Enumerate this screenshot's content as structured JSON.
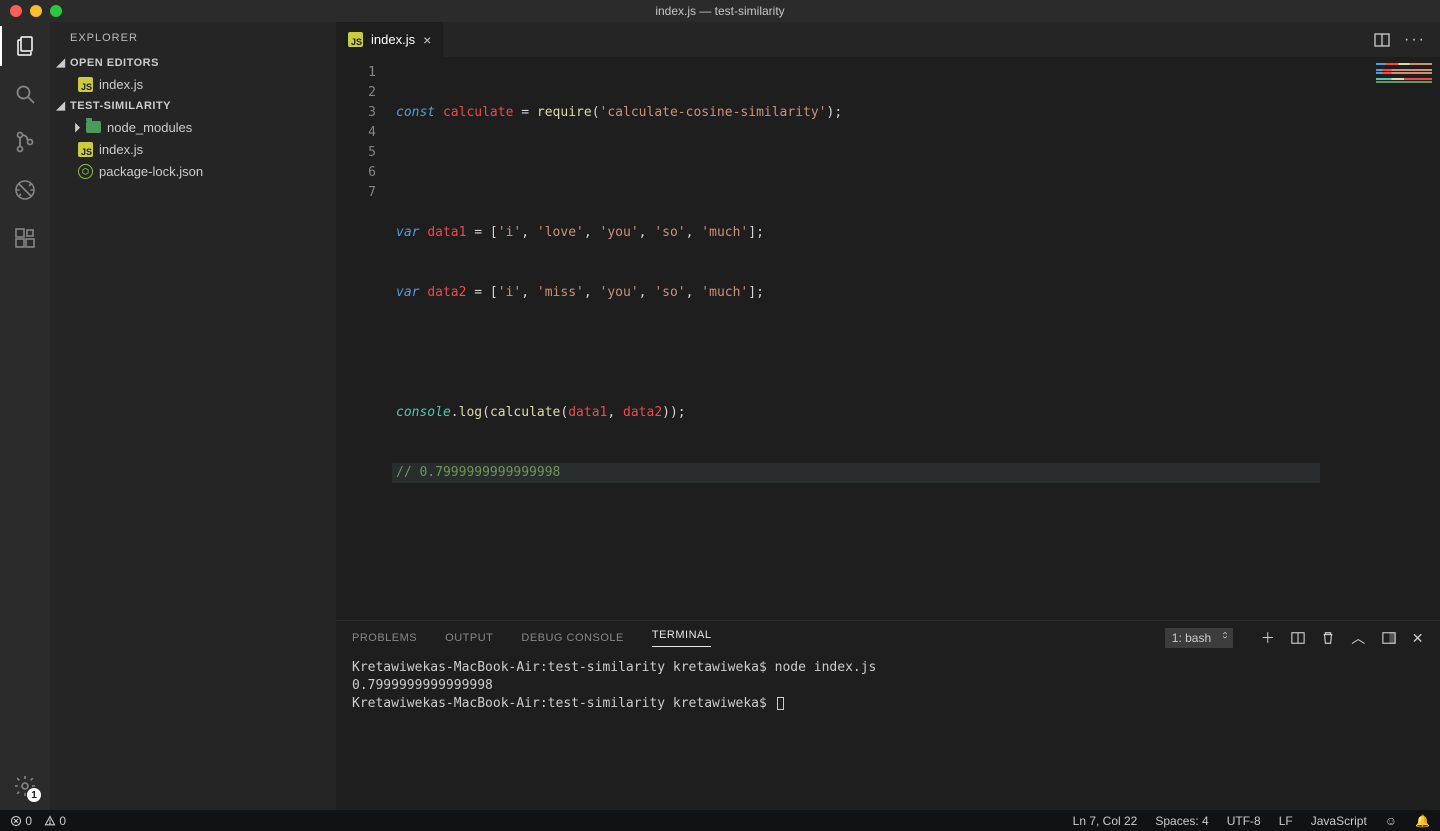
{
  "window": {
    "title": "index.js — test-similarity"
  },
  "sidebar": {
    "title": "EXPLORER",
    "sections": {
      "openEditors": {
        "label": "OPEN EDITORS",
        "items": [
          {
            "label": "index.js",
            "icon": "js"
          }
        ]
      },
      "folder": {
        "label": "TEST-SIMILARITY",
        "items": [
          {
            "label": "node_modules",
            "icon": "folder",
            "expandable": true
          },
          {
            "label": "index.js",
            "icon": "js"
          },
          {
            "label": "package-lock.json",
            "icon": "npm"
          }
        ]
      }
    }
  },
  "tabs": [
    {
      "label": "index.js",
      "icon": "js",
      "active": true
    }
  ],
  "editor": {
    "lines": [
      1,
      2,
      3,
      4,
      5,
      6,
      7
    ],
    "currentLine": 7,
    "code": {
      "l1": {
        "kw": "const",
        "name": "calculate",
        "eq": " = ",
        "fn": "require",
        "op": "(",
        "str": "'calculate-cosine-similarity'",
        "cl": ");"
      },
      "l3": {
        "kw": "var",
        "name": "data1",
        "eq": " = [",
        "s1": "'i'",
        "c1": ", ",
        "s2": "'love'",
        "c2": ", ",
        "s3": "'you'",
        "c3": ", ",
        "s4": "'so'",
        "c4": ", ",
        "s5": "'much'",
        "cl": "];"
      },
      "l4": {
        "kw": "var",
        "name": "data2",
        "eq": " = [",
        "s1": "'i'",
        "c1": ", ",
        "s2": "'miss'",
        "c2": ", ",
        "s3": "'you'",
        "c3": ", ",
        "s4": "'so'",
        "c4": ", ",
        "s5": "'much'",
        "cl": "];"
      },
      "l6": {
        "obj": "console",
        "dot": ".",
        "fn": "log",
        "op": "(",
        "fn2": "calculate",
        "op2": "(",
        "a1": "data1",
        "c": ", ",
        "a2": "data2",
        "cl": "));"
      },
      "l7": {
        "cmt": "// 0.7999999999999998"
      }
    }
  },
  "panel": {
    "tabs": {
      "problems": "PROBLEMS",
      "output": "OUTPUT",
      "debug": "DEBUG CONSOLE",
      "terminal": "TERMINAL"
    },
    "active": "terminal",
    "terminalSelect": "1: bash",
    "terminal": {
      "lines": [
        {
          "prompt": "Kretawiwekas-MacBook-Air:test-similarity kretawiweka$ ",
          "cmd": "node index.js"
        },
        {
          "out": "0.7999999999999998"
        },
        {
          "prompt": "Kretawiwekas-MacBook-Air:test-similarity kretawiweka$ ",
          "cmd": ""
        }
      ]
    }
  },
  "status": {
    "errors": "0",
    "warnings": "0",
    "pos": "Ln 7, Col 22",
    "spaces": "Spaces: 4",
    "enc": "UTF-8",
    "eol": "LF",
    "lang": "JavaScript"
  }
}
